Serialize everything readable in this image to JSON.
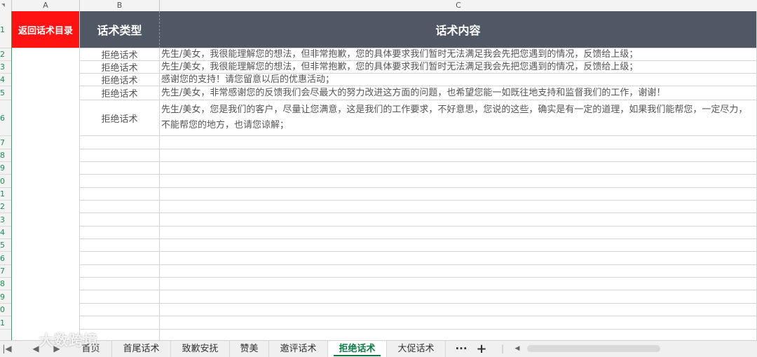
{
  "columns": [
    "A",
    "B",
    "C"
  ],
  "row_numbers": [
    "1",
    "2",
    "3",
    "4",
    "5",
    "6",
    "7",
    "8",
    "9",
    "0",
    "1",
    "2",
    "3",
    "4",
    "5",
    "6",
    "7",
    "8",
    "9",
    "0",
    "1"
  ],
  "header": {
    "back_label": "返回话术目录",
    "type_label": "话术类型",
    "content_label": "话术内容"
  },
  "rows": [
    {
      "type": "拒绝话术",
      "content": "先生/美女，我很能理解您的想法，但非常抱歉，您的具体要求我们暂时无法满足我会先把您遇到的情况，反馈给上级；"
    },
    {
      "type": "拒绝话术",
      "content": "先生/美女，我很能理解您的想法，但非常抱歉，您的具体要求我们暂时无法满足我会先把您遇到的情况，反馈给上级；"
    },
    {
      "type": "拒绝话术",
      "content": "感谢您的支持！请您留意以后的优惠活动；"
    },
    {
      "type": "拒绝话术",
      "content": "先生/美女，非常感谢您的反馈我们会尽最大的努力改进这方面的问题，也希望您能一如既往地支持和监督我们的工作，谢谢！"
    },
    {
      "type": "拒绝话术",
      "content": "先生/美女，您是我们的客户，尽量让您满意，这是我们的工作要求，不好意思，您说的这些，确实是有一定的道理，如果我们能帮您，一定尽力，不能帮您的地方，也请您谅解；"
    }
  ],
  "tabs": [
    {
      "label": "首页",
      "active": false
    },
    {
      "label": "首尾话术",
      "active": false
    },
    {
      "label": "致歉安抚",
      "active": false
    },
    {
      "label": "赞美",
      "active": false
    },
    {
      "label": "邀评话术",
      "active": false
    },
    {
      "label": "拒绝话术",
      "active": true
    },
    {
      "label": "大促话术",
      "active": false
    }
  ],
  "tab_more": "···",
  "tab_add": "+",
  "watermark": "大数跨境",
  "colors": {
    "back_bg": "#ff1212",
    "header_bg": "#515865",
    "active_tab": "#0d7a45",
    "row_header_border": "#27a66a"
  }
}
